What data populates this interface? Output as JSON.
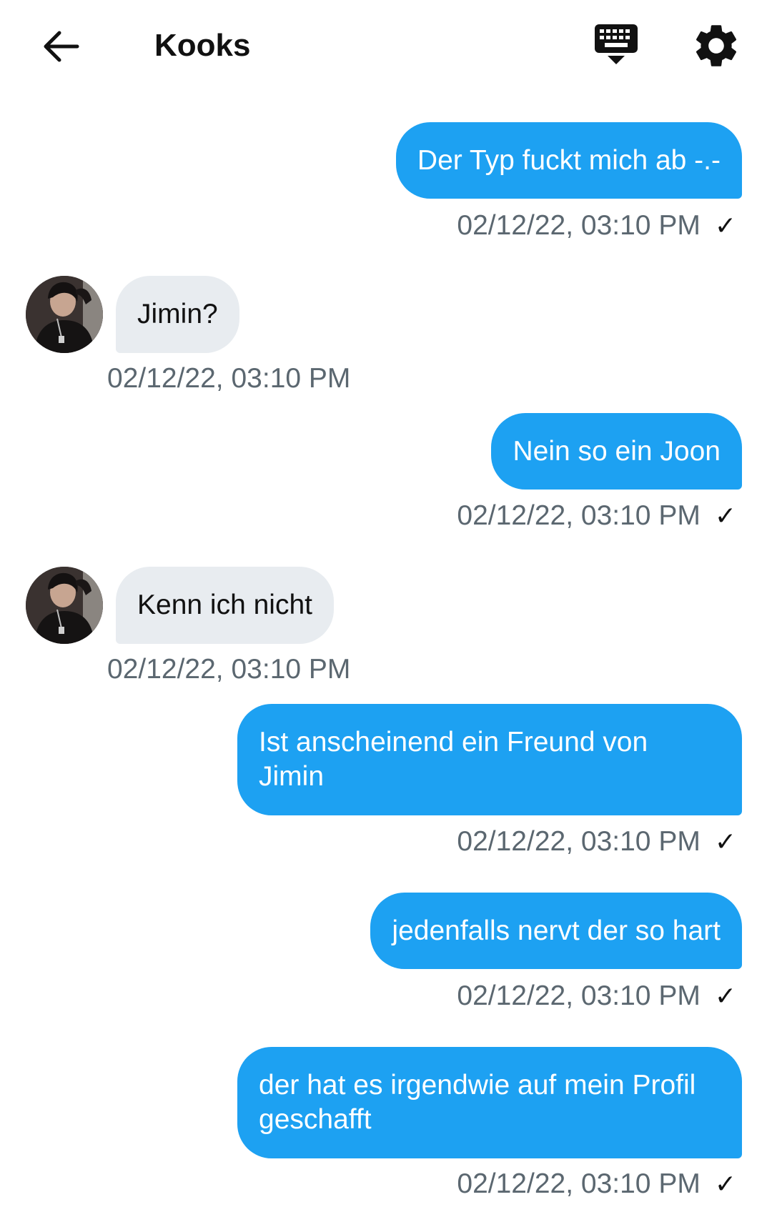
{
  "header": {
    "title": "Kooks",
    "back_icon": "arrow-left-icon",
    "keyboard_icon": "keyboard-icon",
    "settings_icon": "gear-icon"
  },
  "colors": {
    "outgoing_bubble": "#1da1f2",
    "incoming_bubble": "#e8ecf0",
    "timestamp": "#5b6770"
  },
  "messages": [
    {
      "direction": "out",
      "text": "Der Typ fuckt mich ab -.-",
      "timestamp": "02/12/22, 03:10 PM",
      "status": "✓"
    },
    {
      "direction": "in",
      "text": "Jimin?",
      "timestamp": "02/12/22, 03:10 PM"
    },
    {
      "direction": "out",
      "text": "Nein so ein Joon",
      "timestamp": "02/12/22, 03:10 PM",
      "status": "✓"
    },
    {
      "direction": "in",
      "text": "Kenn ich nicht",
      "timestamp": "02/12/22, 03:10 PM"
    },
    {
      "direction": "out",
      "text": "Ist anscheinend ein Freund von Jimin",
      "timestamp": "02/12/22, 03:10 PM",
      "status": "✓"
    },
    {
      "direction": "out",
      "text": "jedenfalls nervt der so hart",
      "timestamp": "02/12/22, 03:10 PM",
      "status": "✓"
    },
    {
      "direction": "out",
      "text": "der hat es irgendwie auf mein Profil geschafft",
      "timestamp": "02/12/22, 03:10 PM",
      "status": "✓"
    }
  ]
}
